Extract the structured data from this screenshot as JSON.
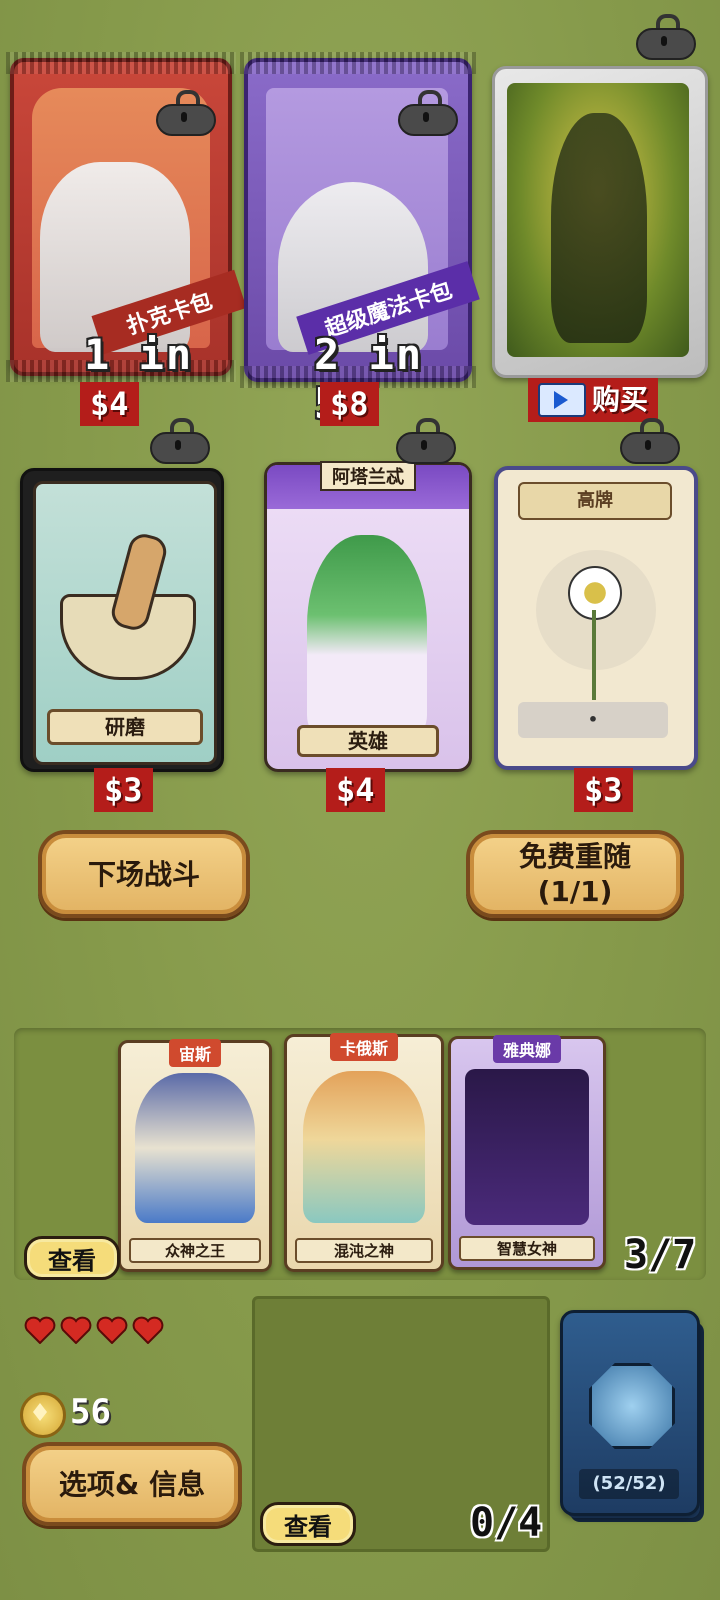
{
  "shop": {
    "packs": [
      {
        "name": "扑克卡包",
        "odds": "1 in 3",
        "price": "$4"
      },
      {
        "name": "超级魔法卡包",
        "odds": "2 in 5",
        "price": "$8"
      }
    ],
    "buy_label": "购买",
    "items": [
      {
        "title": "研磨",
        "price": "$3"
      },
      {
        "header": "阿塔兰忒",
        "title": "英雄",
        "price": "$4"
      },
      {
        "header": "高牌",
        "badge": "•",
        "price": "$3"
      }
    ],
    "fight_button": "下场战斗",
    "reroll_button": "免费重随\n(1/1)"
  },
  "hand": {
    "cards": [
      {
        "name": "宙斯",
        "title": "众神之王"
      },
      {
        "name": "卡俄斯",
        "title": "混沌之神"
      },
      {
        "name": "雅典娜",
        "title": "智慧女神"
      }
    ],
    "view_label": "查看",
    "count": "3/7"
  },
  "player": {
    "hearts": 4,
    "coins": "56",
    "options_button": "选项& 信息"
  },
  "play_zone": {
    "view_label": "查看",
    "count": "0/4"
  },
  "deck": {
    "count": "(52/52)"
  },
  "colors": {
    "background": "#8a9d4f",
    "price_red": "#b41d1a",
    "button_gold": "#f4d28a"
  }
}
